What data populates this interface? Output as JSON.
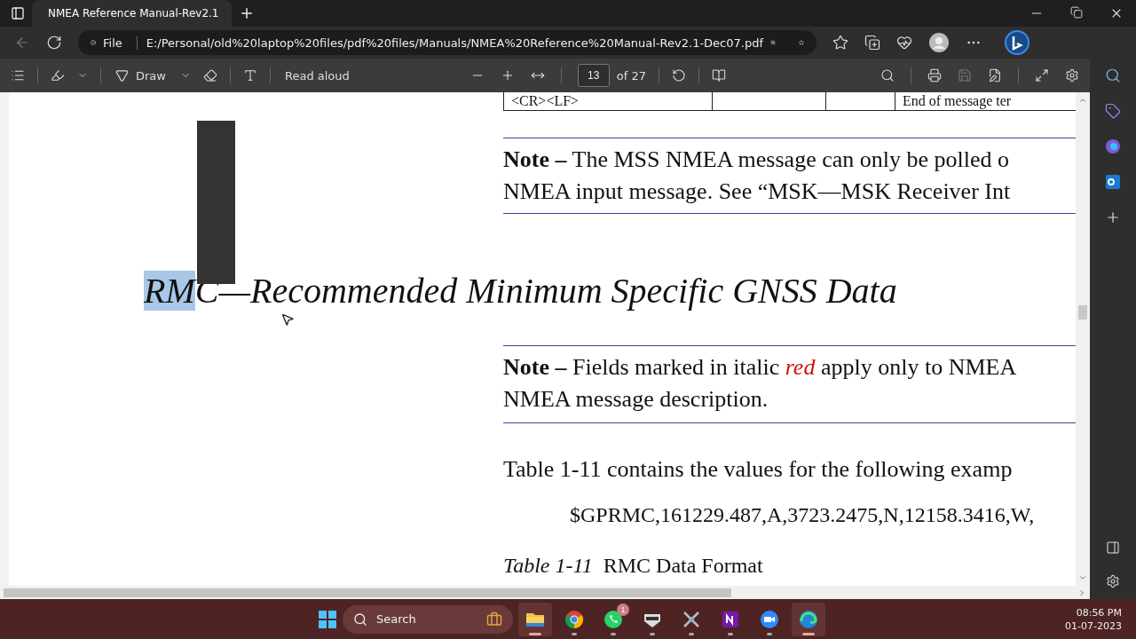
{
  "browser_tabs": [
    {
      "title": "NMEA Reference Manual-Rev2.1",
      "selected": true
    }
  ],
  "address_bar": {
    "scheme": "File",
    "url": "E:/Personal/old%20laptop%20files/pdf%20files/Manuals/NMEA%20Reference%20Manual-Rev2.1-Dec07.pdf"
  },
  "pdf_toolbar": {
    "draw_label": "Draw",
    "read_aloud_label": "Read aloud",
    "page_number": "13",
    "page_count": "of 27"
  },
  "document": {
    "table_row": {
      "first_cell": "<CR><LF>",
      "last_cell": "End of message ter"
    },
    "note_1": [
      "**Note –** The MSS NMEA message can only be polled o",
      "NMEA input message. See “MSK—MSK Receiver Int"
    ],
    "heading": {
      "selected_part": "RM",
      "rest": "C—Recommended Minimum Specific GNSS Data"
    },
    "note_2": {
      "before": "**Note –** Fields marked in italic ",
      "emphasis": "red",
      "after": " apply only to NMEA",
      "second_line": "NMEA message description."
    },
    "paragraph": "Table 1-11 contains the values for the following examp",
    "example": "$GPRMC,161229.487,A,3723.2475,N,12158.3416,W,",
    "caption": {
      "label": "Table 1-11",
      "title": "RMC Data Format"
    }
  },
  "taskbar": {
    "search_placeholder": "Search",
    "apps": [
      {
        "kind": "folder",
        "selected": true
      },
      {
        "kind": "chrome",
        "selected": false
      },
      {
        "kind": "whatsapp",
        "selected": false,
        "badge": "1"
      },
      {
        "kind": "badge-app",
        "selected": false
      },
      {
        "kind": "x-app",
        "selected": false
      },
      {
        "kind": "onenote",
        "selected": false
      },
      {
        "kind": "zoom",
        "selected": false
      },
      {
        "kind": "edge",
        "selected": true
      }
    ],
    "time": "08:56 PM",
    "date": "01-07-2023"
  }
}
